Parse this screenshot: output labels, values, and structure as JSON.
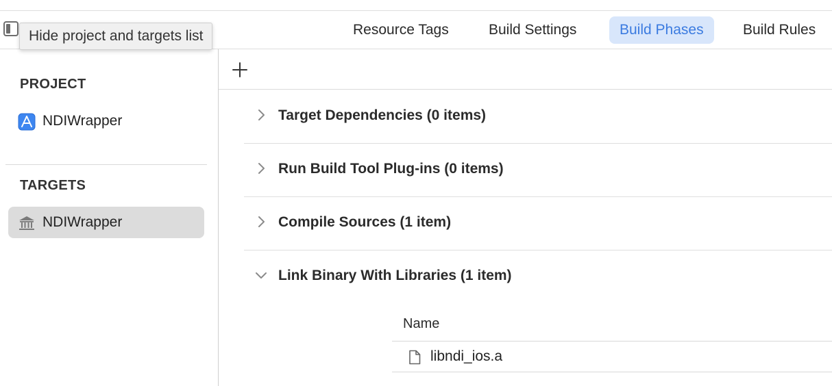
{
  "tabs": [
    {
      "label": "Resource Tags",
      "active": false
    },
    {
      "label": "Build Settings",
      "active": false
    },
    {
      "label": "Build Phases",
      "active": true
    },
    {
      "label": "Build Rules",
      "active": false
    }
  ],
  "tooltip": "Hide project and targets list",
  "sidebar": {
    "project_heading": "PROJECT",
    "project_item": {
      "label": "NDIWrapper",
      "icon": "app-project-icon"
    },
    "targets_heading": "TARGETS",
    "target_item": {
      "label": "NDIWrapper",
      "icon": "library-target-icon",
      "selected": true
    }
  },
  "phases": [
    {
      "title": "Target Dependencies (0 items)",
      "expanded": false
    },
    {
      "title": "Run Build Tool Plug-ins (0 items)",
      "expanded": false
    },
    {
      "title": "Compile Sources (1 item)",
      "expanded": false
    },
    {
      "title": "Link Binary With Libraries (1 item)",
      "expanded": true
    }
  ],
  "library_table": {
    "column_name": "Name",
    "rows": [
      {
        "name": "libndi_ios.a",
        "icon": "document-icon"
      }
    ]
  },
  "colors": {
    "accent": "#3b7be0",
    "active_tab_bg": "#d8e6fb",
    "selected_row_bg": "#dcdcdc"
  }
}
